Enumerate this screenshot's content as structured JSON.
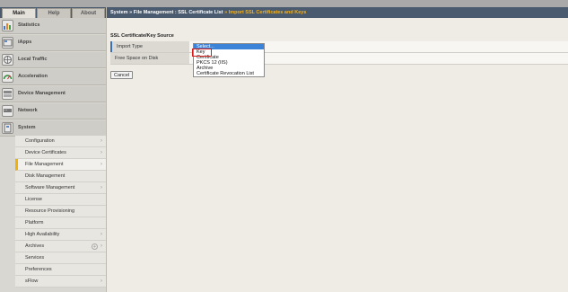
{
  "tabs": [
    "Main",
    "Help",
    "About"
  ],
  "sections": [
    "Statistics",
    "iApps",
    "Local Traffic",
    "Acceleration",
    "Device Management",
    "Network",
    "System"
  ],
  "system_menu": [
    {
      "label": "Configuration",
      "chevron": true
    },
    {
      "label": "Device Certificates",
      "chevron": true
    },
    {
      "label": "File Management",
      "chevron": true,
      "active": true
    },
    {
      "label": "Disk Management",
      "chevron": false
    },
    {
      "label": "Software Management",
      "chevron": true
    },
    {
      "label": "License",
      "chevron": false
    },
    {
      "label": "Resource Provisioning",
      "chevron": false
    },
    {
      "label": "Platform",
      "chevron": false
    },
    {
      "label": "High Availability",
      "chevron": true
    },
    {
      "label": "Archives",
      "chevron": true,
      "plus": true
    },
    {
      "label": "Services",
      "chevron": false
    },
    {
      "label": "Preferences",
      "chevron": false
    },
    {
      "label": "sFlow",
      "chevron": true
    }
  ],
  "breadcrumb": {
    "part1": "System",
    "sep1": " » ",
    "part2": "File Management : SSL Certificate List",
    "sep2": " » ",
    "current": "Import SSL Certificates and Keys"
  },
  "form": {
    "section_title": "SSL Certificate/Key Source",
    "import_type_label": "Import Type",
    "free_space_label": "Free Space on Disk",
    "cancel_label": "Cancel"
  },
  "import_type_options": [
    {
      "label": "Select...",
      "selected": true
    },
    {
      "label": "Key",
      "selected": false
    },
    {
      "label": "Certificate",
      "selected": false
    },
    {
      "label": "PKCS 12 (IIS)",
      "selected": false
    },
    {
      "label": "Archive",
      "selected": false
    },
    {
      "label": "Certificate Revocation List",
      "selected": false
    }
  ],
  "colors": {
    "accent": "#f5b21b",
    "header_bg": "#4b5b6f",
    "highlight_box": "#d31d1d",
    "selected_option": "#3a83d8"
  }
}
